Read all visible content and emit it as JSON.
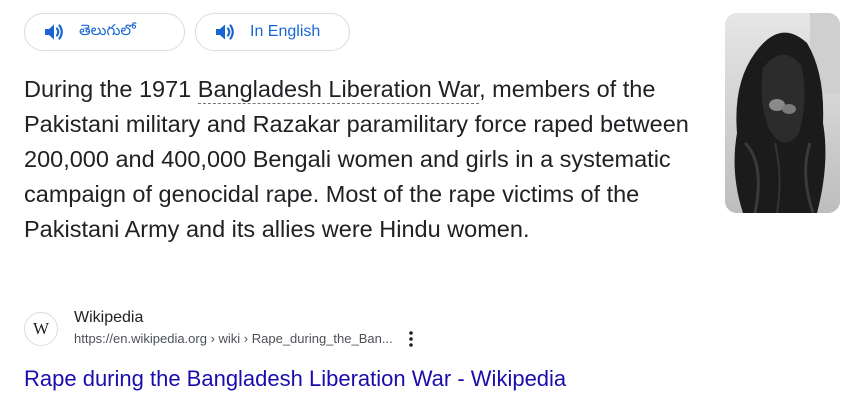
{
  "language_chips": [
    {
      "label": "తెలుగులో",
      "icon": "speaker-icon"
    },
    {
      "label": "In English",
      "icon": "speaker-icon"
    }
  ],
  "snippet": {
    "before": "During the 1971 ",
    "entity": "Bangladesh Liberation War",
    "after": ", members of the Pakistani military and Razakar paramilitary force raped between 200,000 and 400,000 Bengali women and girls in a systematic campaign of genocidal rape. Most of the rape victims of the Pakistani Army and its allies were Hindu women."
  },
  "source": {
    "favicon_letter": "W",
    "site_name": "Wikipedia",
    "url": "https://en.wikipedia.org › wiki › Rape_during_the_Ban...",
    "more_icon": "more-vert-icon"
  },
  "result": {
    "title": "Rape during the Bangladesh Liberation War - Wikipedia"
  },
  "thumbnail": {
    "icon": "photo-thumbnail"
  },
  "colors": {
    "link": "#1a0dab",
    "chip_text": "#1967d2",
    "text": "#202124",
    "url": "#4d5156"
  }
}
